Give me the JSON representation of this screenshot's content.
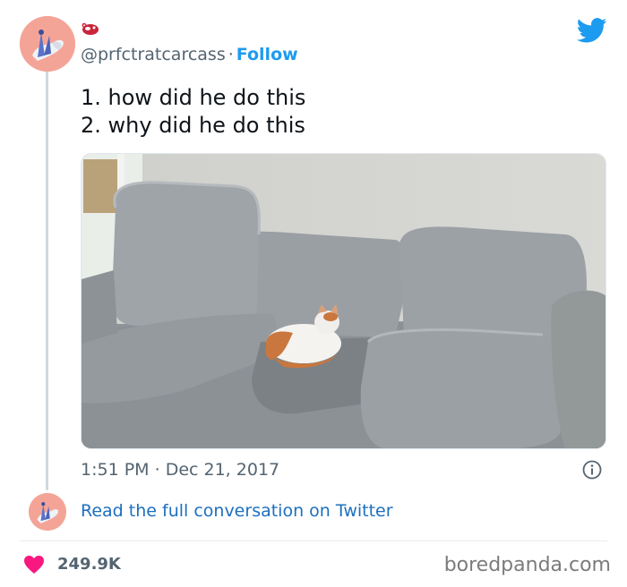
{
  "tweet": {
    "handle": "@prfctratcarcass",
    "separator": "·",
    "follow_label": "Follow",
    "lines": [
      "1. how did he do this",
      "2. why did he do this"
    ],
    "time": "1:51 PM",
    "date": "Dec 21, 2017",
    "read_link": "Read the full conversation on Twitter",
    "likes": "249.9K"
  },
  "footer": {
    "watermark": "boredpanda.com"
  },
  "icons": {
    "bird": "twitter-bird-icon",
    "info": "info-icon",
    "heart": "heart-icon"
  },
  "colors": {
    "accent": "#1d9bf0",
    "heart": "#f91880",
    "muted": "#536471"
  }
}
